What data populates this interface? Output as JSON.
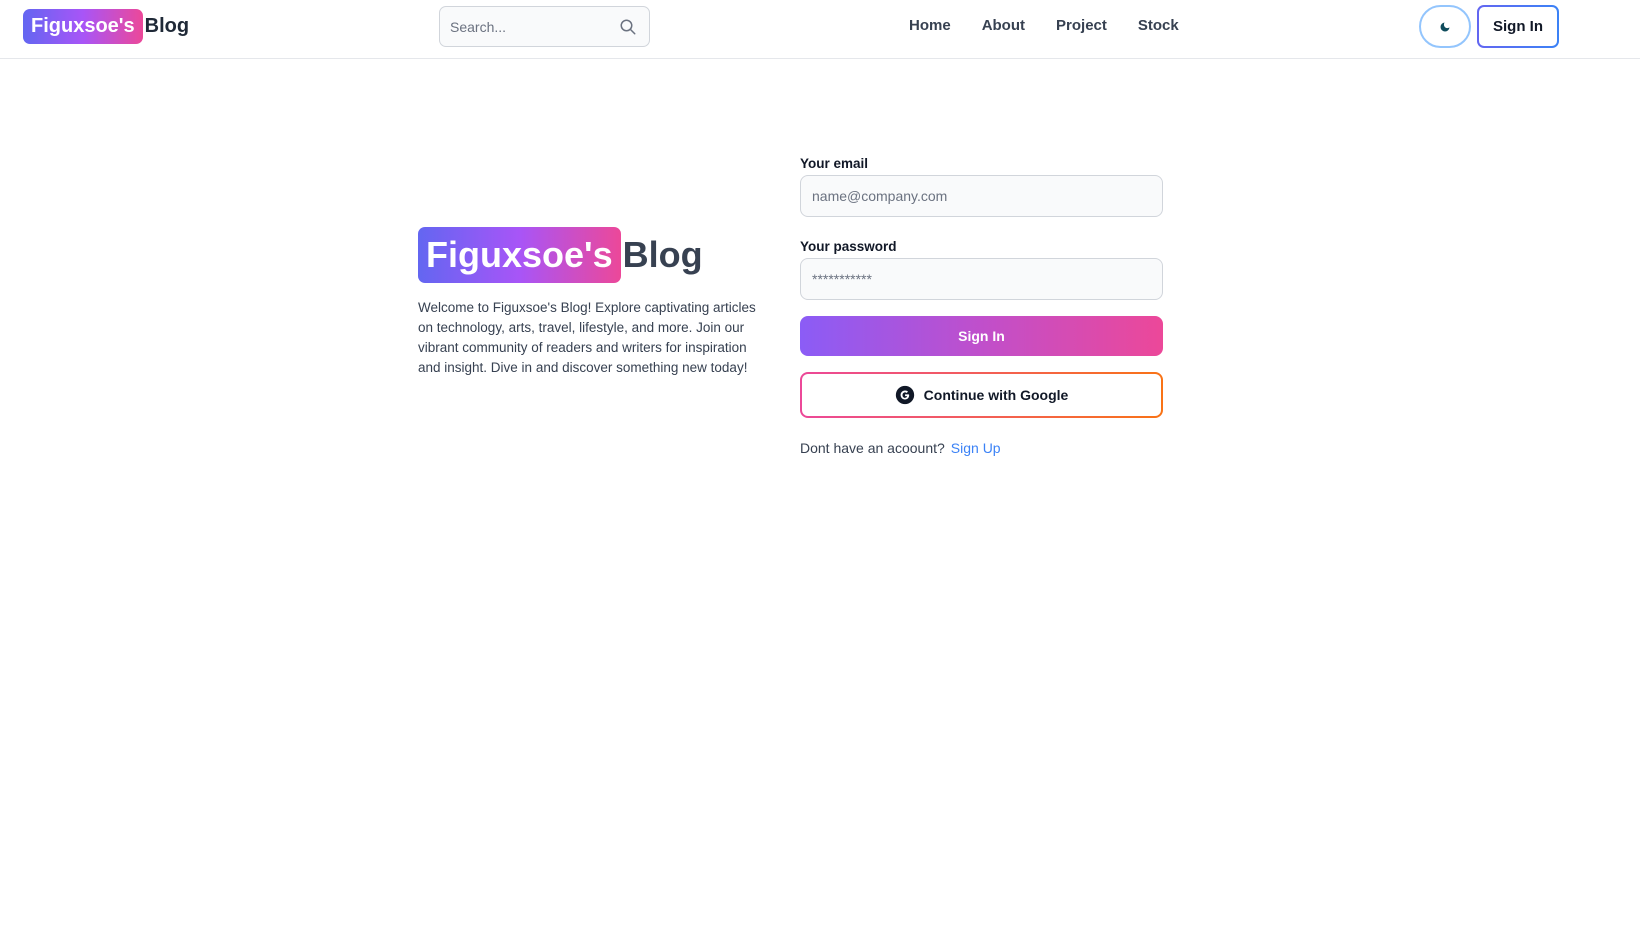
{
  "header": {
    "logo_badge": "Figuxsoe's",
    "logo_text": "Blog",
    "search": {
      "placeholder": "Search..."
    },
    "nav": [
      "Home",
      "About",
      "Project",
      "Stock"
    ],
    "theme_toggle_icon": "moon-icon",
    "sign_in_label": "Sign In"
  },
  "hero": {
    "badge": "Figuxsoe's",
    "text": "Blog",
    "description": "Welcome to Figuxsoe's Blog! Explore captivating articles on technology, arts, travel, lifestyle, and more. Join our vibrant community of readers and writers for inspiration and insight. Dive in and discover something new today!"
  },
  "form": {
    "email_label": "Your email",
    "email_placeholder": "name@company.com",
    "password_label": "Your password",
    "password_placeholder": "***********",
    "submit_label": "Sign In",
    "google_label": "Continue with Google",
    "google_icon": "google-icon",
    "no_account_text": "Dont have an acoount?",
    "signup_link": "Sign Up"
  },
  "colors": {
    "brand_gradient_start": "#6366f1",
    "brand_gradient_end": "#ec4899",
    "link": "#3b82f6"
  }
}
